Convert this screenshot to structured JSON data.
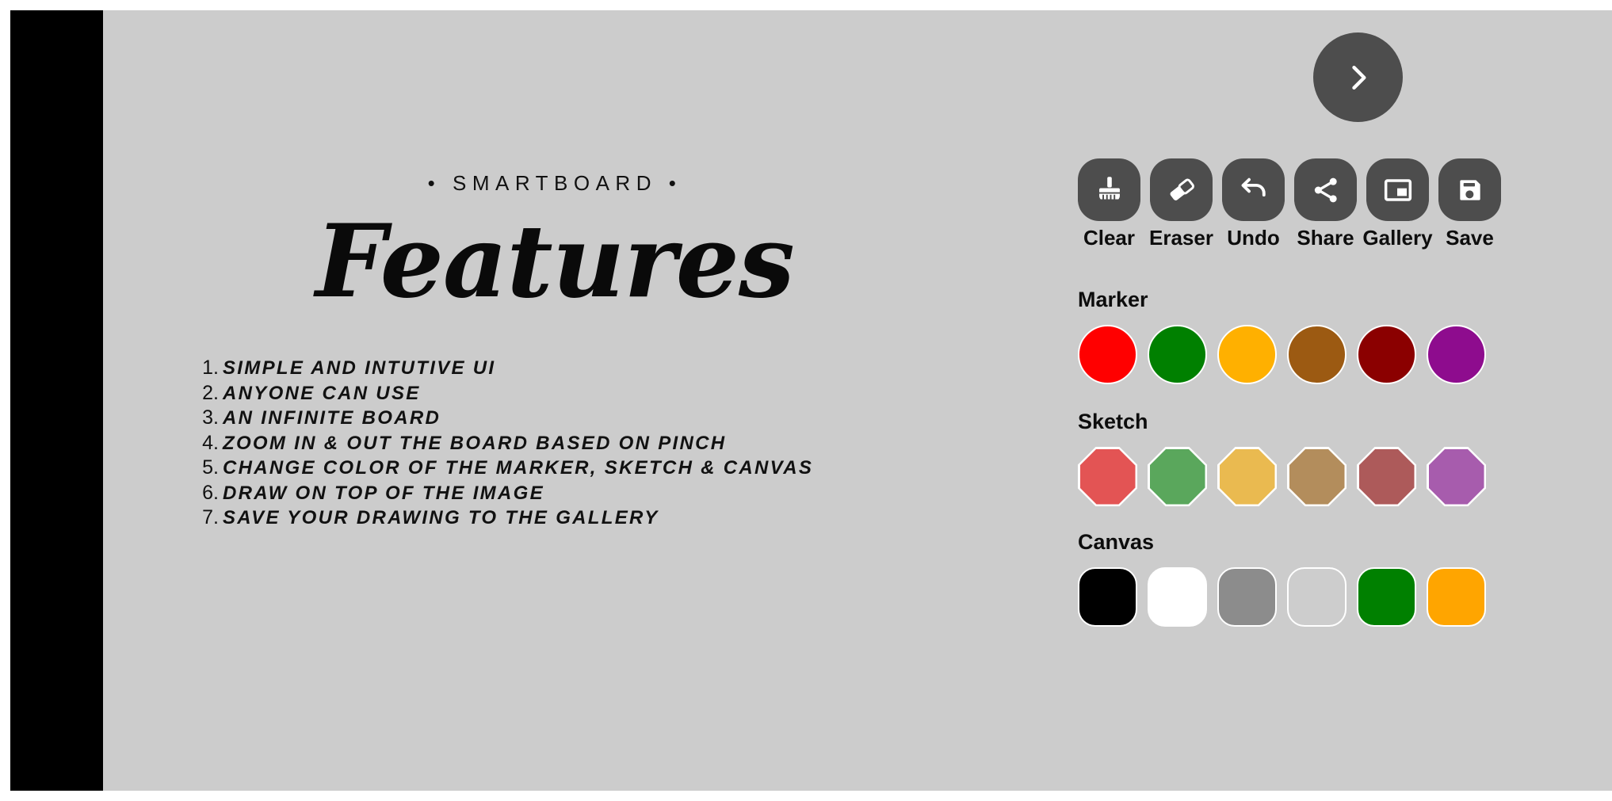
{
  "theme": {
    "page_background": "#cccccc",
    "frame_background": "#ffffff",
    "left_bar_color": "#000000",
    "button_color": "#4d4d4d",
    "text_color": "#111111"
  },
  "hero": {
    "eyebrow": "• SMARTBOARD •",
    "title": "Features",
    "features": [
      {
        "num": "1.",
        "text": "SIMPLE AND INTUTIVE UI"
      },
      {
        "num": "2.",
        "text": "ANYONE CAN USE"
      },
      {
        "num": "3.",
        "text": "AN INFINITE BOARD"
      },
      {
        "num": "4.",
        "text": "ZOOM IN & OUT THE BOARD BASED ON PINCH"
      },
      {
        "num": "5.",
        "text": "CHANGE COLOR OF THE MARKER, SKETCH & CANVAS"
      },
      {
        "num": "6.",
        "text": "DRAW ON TOP OF THE IMAGE"
      },
      {
        "num": "7.",
        "text": "SAVE YOUR DRAWING TO THE GALLERY"
      }
    ]
  },
  "panel": {
    "collapse_button": {
      "icon": "chevron-right-icon"
    },
    "tools": [
      {
        "label": "Clear",
        "icon": "brush-icon"
      },
      {
        "label": "Eraser",
        "icon": "eraser-icon"
      },
      {
        "label": "Undo",
        "icon": "undo-icon"
      },
      {
        "label": "Share",
        "icon": "share-icon"
      },
      {
        "label": "Gallery",
        "icon": "gallery-icon"
      },
      {
        "label": "Save",
        "icon": "save-floppy-icon"
      }
    ],
    "sections": [
      {
        "label": "Marker",
        "shape": "circle",
        "colors": [
          "#ff0000",
          "#008000",
          "#ffb000",
          "#9c5a12",
          "#8b0000",
          "#8e0c8e"
        ]
      },
      {
        "label": "Sketch",
        "shape": "octagon",
        "colors": [
          "#e35454",
          "#5aa75c",
          "#eaba50",
          "#b38d5c",
          "#ad5a5a",
          "#a75cad"
        ]
      },
      {
        "label": "Canvas",
        "shape": "rounded",
        "colors": [
          "#000000",
          "#ffffff",
          "#8c8c8c",
          "#cdcdcd",
          "#008000",
          "#ffa500"
        ]
      }
    ]
  }
}
